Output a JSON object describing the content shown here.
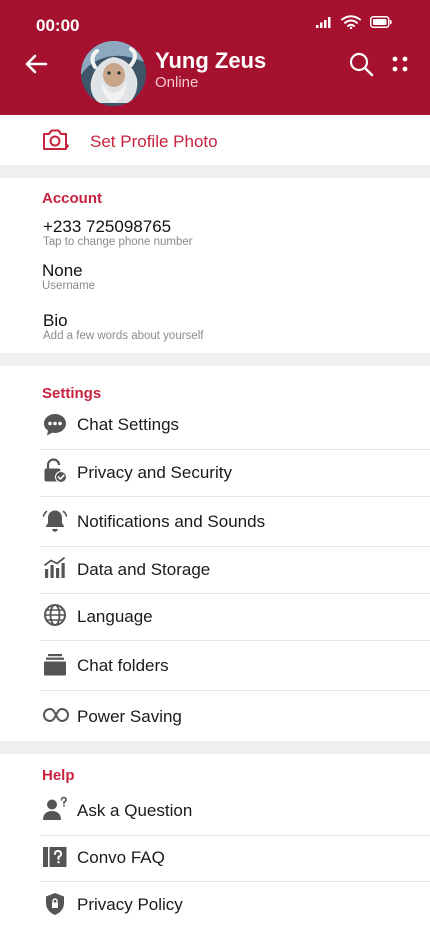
{
  "status_bar": {
    "time": "00:00"
  },
  "header": {
    "name": "Yung Zeus",
    "status": "Online",
    "colors": {
      "background": "#a5112f",
      "accent": "#c8223e"
    }
  },
  "profile_photo": {
    "label": "Set Profile Photo",
    "icon": "camera-add-icon"
  },
  "account": {
    "title": "Account",
    "phone": {
      "value": "+233 725098765",
      "hint": "Tap to change phone number"
    },
    "username": {
      "value": "None",
      "hint": "Username"
    },
    "bio": {
      "value": "Bio",
      "hint": "Add a few words about yourself"
    }
  },
  "settings": {
    "title": "Settings",
    "items": [
      {
        "label": "Chat Settings",
        "icon": "chat-bubble-icon"
      },
      {
        "label": "Privacy and Security",
        "icon": "lock-check-icon"
      },
      {
        "label": "Notifications and Sounds",
        "icon": "bell-icon"
      },
      {
        "label": "Data and Storage",
        "icon": "bar-chart-icon"
      },
      {
        "label": "Language",
        "icon": "globe-icon"
      },
      {
        "label": "Chat folders",
        "icon": "folders-icon"
      },
      {
        "label": "Power Saving",
        "icon": "battery-saver-icon"
      }
    ]
  },
  "help": {
    "title": "Help",
    "items": [
      {
        "label": "Ask a Question",
        "icon": "ask-question-icon"
      },
      {
        "label": "Convo FAQ",
        "icon": "faq-icon"
      },
      {
        "label": "Privacy Policy",
        "icon": "shield-icon"
      }
    ]
  }
}
